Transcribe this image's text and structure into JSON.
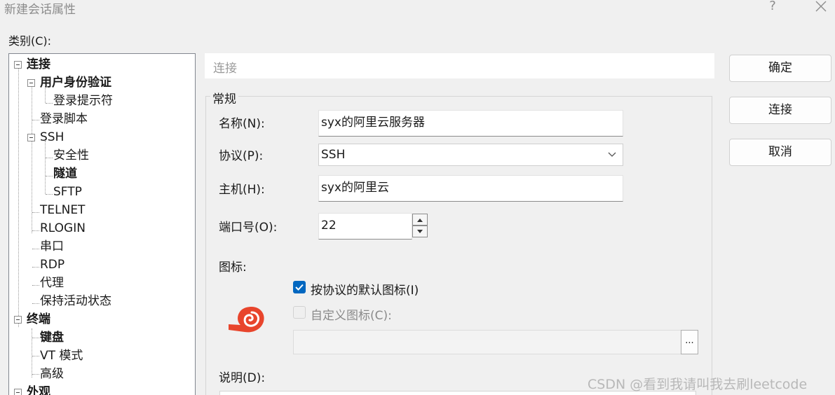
{
  "window": {
    "title": "新建会话属性",
    "help_label": "?",
    "close_icon": "close-icon"
  },
  "category": {
    "label": "类别(C):"
  },
  "tree": {
    "items": [
      {
        "label": "连接",
        "bold": true,
        "expanded": true,
        "selected": false
      },
      {
        "label": "用户身份验证",
        "bold": true,
        "expanded": true
      },
      {
        "label": "登录提示符",
        "bold": false
      },
      {
        "label": "登录脚本",
        "bold": false
      },
      {
        "label": "SSH",
        "bold": false,
        "expanded": true
      },
      {
        "label": "安全性",
        "bold": false
      },
      {
        "label": "隧道",
        "bold": true
      },
      {
        "label": "SFTP",
        "bold": false
      },
      {
        "label": "TELNET",
        "bold": false
      },
      {
        "label": "RLOGIN",
        "bold": false
      },
      {
        "label": "串口",
        "bold": false
      },
      {
        "label": "RDP",
        "bold": false
      },
      {
        "label": "代理",
        "bold": false
      },
      {
        "label": "保持活动状态",
        "bold": false
      },
      {
        "label": "终端",
        "bold": true,
        "expanded": true
      },
      {
        "label": "键盘",
        "bold": true
      },
      {
        "label": "VT 模式",
        "bold": false
      },
      {
        "label": "高级",
        "bold": false
      },
      {
        "label": "外观",
        "bold": true,
        "expanded": true
      }
    ]
  },
  "section": {
    "title": "连接"
  },
  "general": {
    "legend": "常规",
    "name_label": "名称(N):",
    "name_value": "syx的阿里云服务器",
    "protocol_label": "协议(P):",
    "protocol_value": "SSH",
    "host_label": "主机(H):",
    "host_value": "syx的阿里云",
    "port_label": "端口号(O):",
    "port_value": "22",
    "icon_label": "图标:",
    "default_icon_label": "按协议的默认图标(I)",
    "default_icon_checked": true,
    "custom_icon_label": "自定义图标(C):",
    "custom_icon_checked": false,
    "browse_label": "...",
    "description_label": "说明(D):"
  },
  "buttons": {
    "ok": "确定",
    "connect": "连接",
    "cancel": "取消"
  },
  "watermark": "CSDN @看到我请叫我去刷leetcode",
  "colors": {
    "accent": "#0067c0",
    "protocol_icon": "#e8452c"
  }
}
